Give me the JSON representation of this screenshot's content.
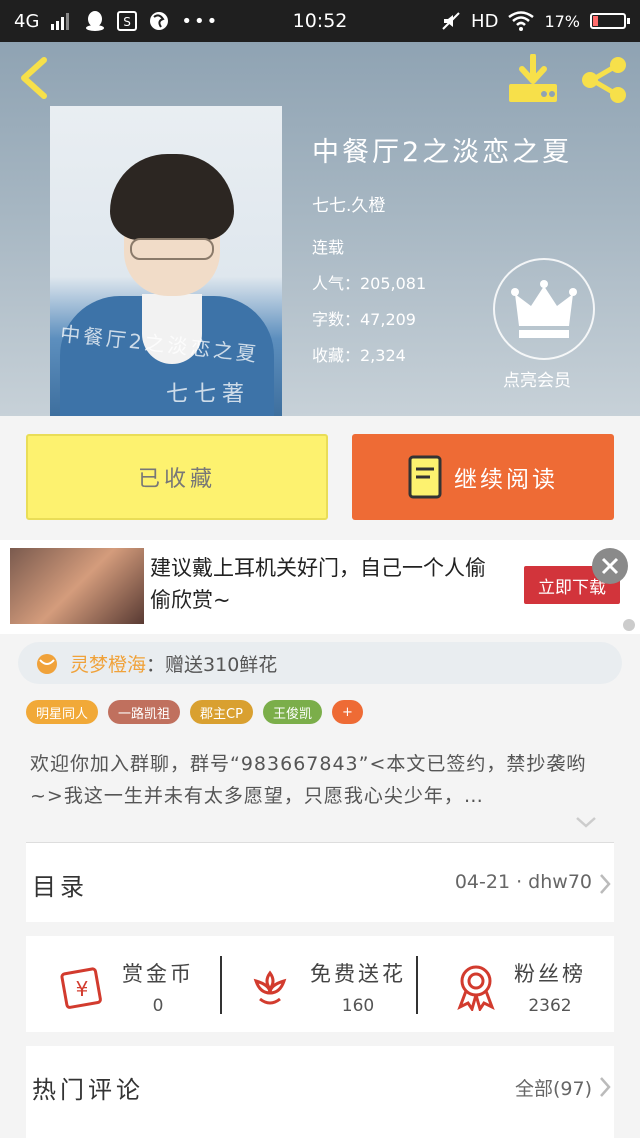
{
  "status_bar": {
    "network": "4G",
    "time": "10:52",
    "hd": "HD",
    "battery_percent": "17%",
    "battery_level": 0.17,
    "icons": [
      "signal-icon",
      "qq-icon",
      "sogou-icon",
      "browser-icon",
      "more-icon",
      "mute-icon",
      "wifi-icon",
      "battery-icon"
    ]
  },
  "header": {
    "book_title": "中餐厅2之淡恋之夏",
    "author": "七七.久橙",
    "status": "连载",
    "popularity": "人气：205,081",
    "word_count": "字数：47,209",
    "favorites": "收藏：2,324",
    "vip_label": "点亮会员",
    "cover_text": "中餐厅2之淡恋之夏",
    "cover_author": "七七著"
  },
  "actions": {
    "favorited_label": "已收藏",
    "continue_label": "继续阅读",
    "colors": {
      "favorited": "#fdf26f",
      "continue": "#ee6b35"
    }
  },
  "ad": {
    "text": "建议戴上耳机关好门，自己一个人偷偷欣赏~",
    "button": "立即下载"
  },
  "gift": {
    "giver": "灵梦橙海",
    "text": "：赠送310鲜花"
  },
  "tags": [
    {
      "label": "明星同人",
      "color": "#f1a938"
    },
    {
      "label": "一路凯祖",
      "color": "#c0705e"
    },
    {
      "label": "郡主CP",
      "color": "#d9a030"
    },
    {
      "label": "王俊凯",
      "color": "#7bae4a"
    },
    {
      "label": "+",
      "color": "#ee6b35"
    }
  ],
  "description": "欢迎你加入群聊，群号“983667843”<本文已签约，禁抄袭哟~>我这一生并未有太多愿望，只愿我心尖少年，…",
  "catalog": {
    "title": "目录",
    "latest": "04-21 · dhw70"
  },
  "stats": [
    {
      "label": "赏金币",
      "value": "0",
      "icon": "reward-coin-icon"
    },
    {
      "label": "免费送花",
      "value": "160",
      "icon": "flower-icon"
    },
    {
      "label": "粉丝榜",
      "value": "2362",
      "icon": "rank-medal-icon"
    }
  ],
  "comments": {
    "title": "热门评论",
    "all": "全部(97)"
  }
}
